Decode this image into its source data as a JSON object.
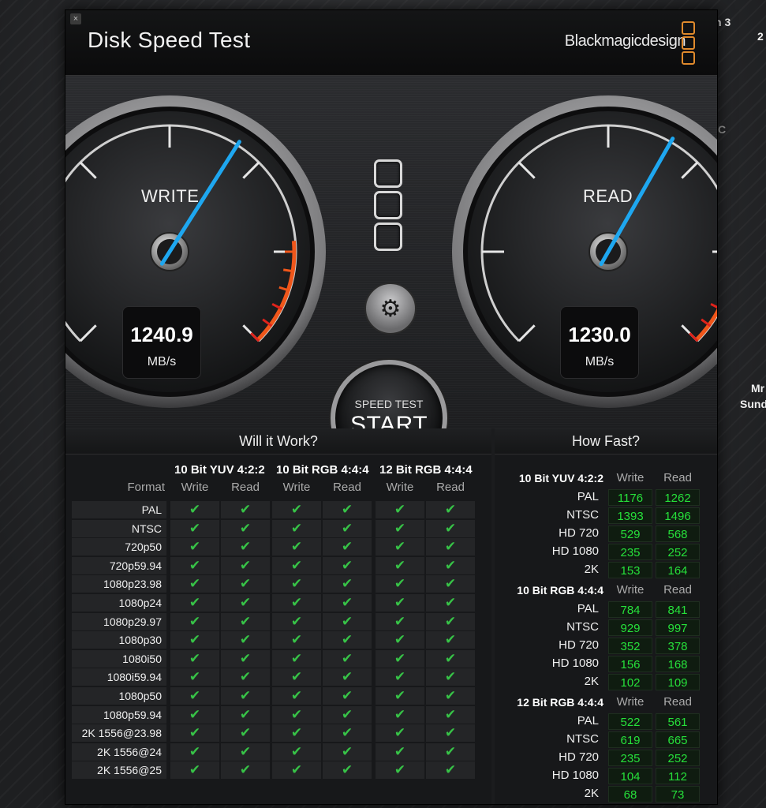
{
  "desktop": {
    "frag1": "h 3",
    "frag2": "2",
    "frag3": "C",
    "frag4": "Mr",
    "frag5": "Sund"
  },
  "window": {
    "title": "Disk Speed Test",
    "brand": "Blackmagicdesign",
    "close_glyph": "×"
  },
  "gauges": {
    "write": {
      "label": "WRITE",
      "value": "1240.9",
      "unit": "MB/s",
      "needle_fraction": 0.62
    },
    "read": {
      "label": "READ",
      "value": "1230.0",
      "unit": "MB/s",
      "needle_fraction": 0.61
    }
  },
  "controls": {
    "start_small": "SPEED TEST",
    "start_big": "START",
    "gear_glyph": "⚙",
    "gear_icon": "gear-icon"
  },
  "will_it_work": {
    "title": "Will it Work?",
    "format_label": "Format",
    "groups": [
      "10 Bit YUV 4:2:2",
      "10 Bit RGB 4:4:4",
      "12 Bit RGB 4:4:4"
    ],
    "write_label": "Write",
    "read_label": "Read",
    "check_glyph": "✔",
    "formats": [
      "PAL",
      "NTSC",
      "720p50",
      "720p59.94",
      "1080p23.98",
      "1080p24",
      "1080p29.97",
      "1080p30",
      "1080i50",
      "1080i59.94",
      "1080p50",
      "1080p59.94",
      "2K 1556@23.98",
      "2K 1556@24",
      "2K 1556@25"
    ]
  },
  "how_fast": {
    "title": "How Fast?",
    "write_label": "Write",
    "read_label": "Read",
    "groups": [
      {
        "name": "10 Bit YUV 4:2:2",
        "rows": [
          {
            "format": "PAL",
            "write": "1176",
            "read": "1262"
          },
          {
            "format": "NTSC",
            "write": "1393",
            "read": "1496"
          },
          {
            "format": "HD 720",
            "write": "529",
            "read": "568"
          },
          {
            "format": "HD 1080",
            "write": "235",
            "read": "252"
          },
          {
            "format": "2K",
            "write": "153",
            "read": "164"
          }
        ]
      },
      {
        "name": "10 Bit RGB 4:4:4",
        "rows": [
          {
            "format": "PAL",
            "write": "784",
            "read": "841"
          },
          {
            "format": "NTSC",
            "write": "929",
            "read": "997"
          },
          {
            "format": "HD 720",
            "write": "352",
            "read": "378"
          },
          {
            "format": "HD 1080",
            "write": "156",
            "read": "168"
          },
          {
            "format": "2K",
            "write": "102",
            "read": "109"
          }
        ]
      },
      {
        "name": "12 Bit RGB 4:4:4",
        "rows": [
          {
            "format": "PAL",
            "write": "522",
            "read": "561"
          },
          {
            "format": "NTSC",
            "write": "619",
            "read": "665"
          },
          {
            "format": "HD 720",
            "write": "235",
            "read": "252"
          },
          {
            "format": "HD 1080",
            "write": "104",
            "read": "112"
          },
          {
            "format": "2K",
            "write": "68",
            "read": "73"
          }
        ]
      }
    ]
  },
  "colors": {
    "check": "#37c247",
    "value_green": "#26e03a",
    "needle": "#1ea7f0",
    "redzone": "#e0231b",
    "orangezone": "#f0561a",
    "logo_orange": "#e08a2c"
  }
}
